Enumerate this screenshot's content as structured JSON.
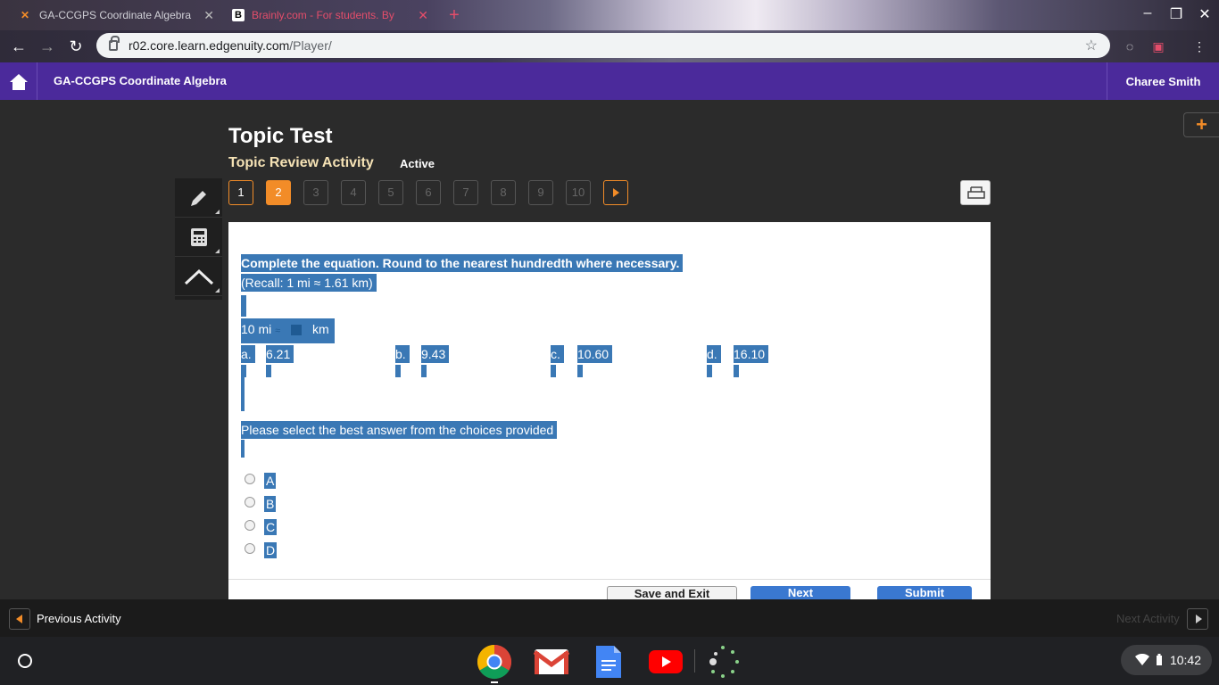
{
  "browser": {
    "tabs": [
      {
        "title": "GA-CCGPS Coordinate Algebra",
        "favicon": "edgenuity-icon"
      },
      {
        "title": "Brainly.com - For students. By",
        "favicon": "brainly-icon"
      }
    ],
    "url_host": "r02.core.learn.edgenuity.com",
    "url_path": "/Player/"
  },
  "header": {
    "course": "GA-CCGPS Coordinate Algebra",
    "user": "Charee Smith"
  },
  "activity": {
    "title": "Topic Test",
    "subtitle": "Topic Review Activity",
    "status": "Active",
    "questions": [
      "1",
      "2",
      "3",
      "4",
      "5",
      "6",
      "7",
      "8",
      "9",
      "10"
    ],
    "current_question": "2"
  },
  "question": {
    "prompt": "Complete the equation. Round to the nearest hundredth where necessary.",
    "recall": "(Recall: 1 mi ≈ 1.61 km)",
    "eq_left": "10 mi",
    "eq_symbol": "≈",
    "eq_right": "km",
    "choices": [
      {
        "letter": "a.",
        "value": "6.21"
      },
      {
        "letter": "b.",
        "value": "9.43"
      },
      {
        "letter": "c.",
        "value": "10.60"
      },
      {
        "letter": "d.",
        "value": "16.10"
      }
    ],
    "instruction": "Please select the best answer from the choices provided",
    "options": [
      "A",
      "B",
      "C",
      "D"
    ]
  },
  "buttons": {
    "save_exit": "Save and Exit",
    "next": "Next",
    "submit": "Submit"
  },
  "footer": {
    "previous": "Previous Activity",
    "next": "Next Activity"
  },
  "system": {
    "time": "10:42"
  },
  "colors": {
    "header_purple": "#4b2a9b",
    "accent_orange": "#f28c28",
    "selection_blue": "#3a78b5"
  }
}
